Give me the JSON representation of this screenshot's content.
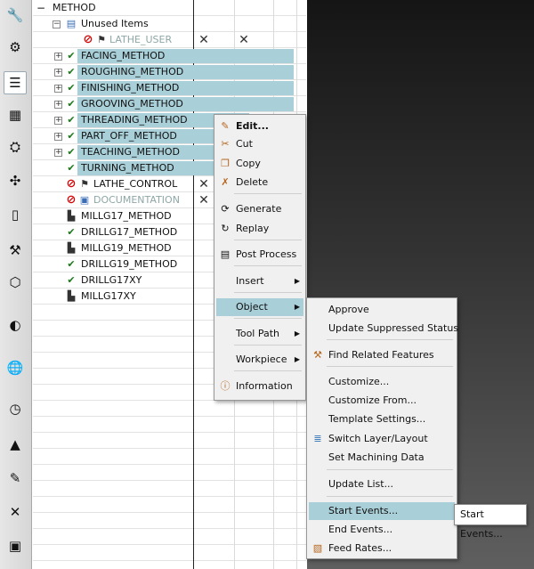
{
  "sidebar": {
    "icons": [
      "resource-bar-icon-1",
      "resource-bar-icon-2",
      "operation-navigator-icon",
      "machine-tool-navigator-icon",
      "part-navigator-icon",
      "assembly-navigator-icon",
      "reuse-library-icon",
      "history-icon",
      "process-navigator-icon",
      "feature-navigator-icon",
      "web-browser-icon",
      "history-clock-icon",
      "palette-icon",
      "training-icon",
      "role-icon",
      "system-scene-icon"
    ]
  },
  "tree": {
    "root": "METHOD",
    "unused": "Unused Items",
    "lathe_user": "LATHE_USER",
    "items": [
      "FACING_METHOD",
      "ROUGHING_METHOD",
      "FINISHING_METHOD",
      "GROOVING_METHOD",
      "THREADING_METHOD",
      "PART_OFF_METHOD",
      "TEACHING_METHOD",
      "TURNING_METHOD"
    ],
    "lathe_control": "LATHE_CONTROL",
    "documentation": "DOCUMENTATION",
    "mill_items": [
      "MILLG17_METHOD",
      "DRILLG17_METHOD",
      "MILLG19_METHOD",
      "DRILLG19_METHOD",
      "DRILLG17XY",
      "MILLG17XY"
    ],
    "x_mark": "✕"
  },
  "context_menu": {
    "edit": "Edit...",
    "cut": "Cut",
    "copy": "Copy",
    "delete": "Delete",
    "generate": "Generate",
    "replay": "Replay",
    "post_process": "Post Process",
    "insert": "Insert",
    "object": "Object",
    "tool_path": "Tool Path",
    "workpiece": "Workpiece",
    "information": "Information",
    "arrow": "▶"
  },
  "object_menu": {
    "approve": "Approve",
    "update_suppressed": "Update Suppressed Status",
    "find_related": "Find Related Features",
    "customize": "Customize...",
    "customize_from": "Customize From...",
    "template_settings": "Template Settings...",
    "switch_layer": "Switch Layer/Layout",
    "set_machining": "Set Machining Data",
    "update_list": "Update List...",
    "start_events": "Start Events...",
    "end_events": "End Events...",
    "feed_rates": "Feed Rates..."
  },
  "tooltip": {
    "text": "Start Events..."
  },
  "colors": {
    "selection": "#a9cfd8",
    "menu_bg": "#f0f0f0"
  }
}
